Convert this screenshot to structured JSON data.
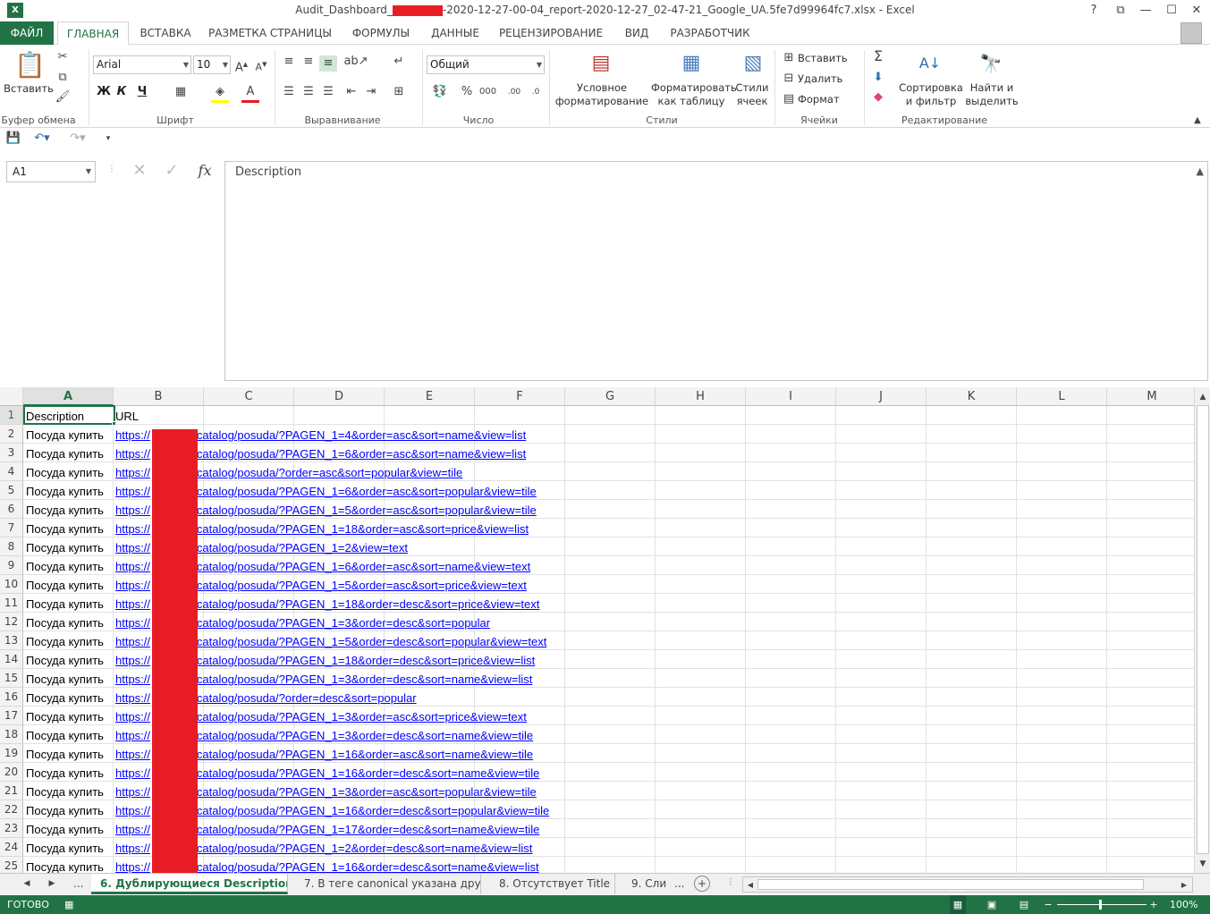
{
  "window": {
    "title_prefix": "Audit_Dashboard_",
    "title_suffix": "-2020-12-27-00-04_report-2020-12-27_02-47-21_Google_UA.5fe7d99964fc7.xlsx - Excel",
    "help": "?",
    "restore": "⧉",
    "minimize": "—",
    "maximize": "☐",
    "close": "✕"
  },
  "ribbon_tabs": [
    "ФАЙЛ",
    "ГЛАВНАЯ",
    "ВСТАВКА",
    "РАЗМЕТКА СТРАНИЦЫ",
    "ФОРМУЛЫ",
    "ДАННЫЕ",
    "РЕЦЕНЗИРОВАНИЕ",
    "ВИД",
    "РАЗРАБОТЧИК"
  ],
  "ribbon": {
    "paste": "Вставить",
    "font_name": "Arial",
    "font_size": "10",
    "bold": "Ж",
    "italic": "К",
    "underline": "Ч",
    "number_format": "Общий",
    "cond_format_1": "Условное",
    "cond_format_2": "форматирование",
    "format_table_1": "Форматировать",
    "format_table_2": "как таблицу",
    "cell_styles_1": "Стили",
    "cell_styles_2": "ячеек",
    "insert": "Вставить",
    "delete": "Удалить",
    "format": "Формат",
    "sort_1": "Сортировка",
    "sort_2": "и фильтр",
    "find_1": "Найти и",
    "find_2": "выделить",
    "groups": {
      "clipboard": "Буфер обмена",
      "font": "Шрифт",
      "alignment": "Выравнивание",
      "number": "Число",
      "styles": "Стили",
      "cells": "Ячейки",
      "editing": "Редактирование"
    }
  },
  "formula_bar": {
    "name_box": "A1",
    "fx": "fx",
    "content": "Description"
  },
  "columns": [
    "A",
    "B",
    "C",
    "D",
    "E",
    "F",
    "G",
    "H",
    "I",
    "J",
    "K",
    "L",
    "M"
  ],
  "rows": [
    {
      "n": "1",
      "a": "Description",
      "b": "URL"
    },
    {
      "n": "2",
      "a": "Посуда  купить",
      "b": "https://",
      "c": "u/catalog/posuda/?PAGEN_1=4&order=asc&sort=name&view=list"
    },
    {
      "n": "3",
      "a": "Посуда  купить",
      "b": "https://",
      "c": "u/catalog/posuda/?PAGEN_1=6&order=asc&sort=name&view=list"
    },
    {
      "n": "4",
      "a": "Посуда  купить",
      "b": "https://",
      "c": "u/catalog/posuda/?order=asc&sort=popular&view=tile"
    },
    {
      "n": "5",
      "a": "Посуда  купить",
      "b": "https://",
      "c": "u/catalog/posuda/?PAGEN_1=6&order=asc&sort=popular&view=tile"
    },
    {
      "n": "6",
      "a": "Посуда  купить",
      "b": "https://",
      "c": "u/catalog/posuda/?PAGEN_1=5&order=asc&sort=popular&view=tile"
    },
    {
      "n": "7",
      "a": "Посуда  купить",
      "b": "https://",
      "c": "u/catalog/posuda/?PAGEN_1=18&order=asc&sort=price&view=list"
    },
    {
      "n": "8",
      "a": "Посуда  купить",
      "b": "https://",
      "c": "u/catalog/posuda/?PAGEN_1=2&view=text"
    },
    {
      "n": "9",
      "a": "Посуда  купить",
      "b": "https://",
      "c": "u/catalog/posuda/?PAGEN_1=6&order=asc&sort=name&view=text"
    },
    {
      "n": "10",
      "a": "Посуда  купить",
      "b": "https://",
      "c": "u/catalog/posuda/?PAGEN_1=5&order=asc&sort=price&view=text"
    },
    {
      "n": "11",
      "a": "Посуда  купить",
      "b": "https://",
      "c": "u/catalog/posuda/?PAGEN_1=18&order=desc&sort=price&view=text"
    },
    {
      "n": "12",
      "a": "Посуда  купить",
      "b": "https://",
      "c": "u/catalog/posuda/?PAGEN_1=3&order=desc&sort=popular"
    },
    {
      "n": "13",
      "a": "Посуда  купить",
      "b": "https://",
      "c": "u/catalog/posuda/?PAGEN_1=5&order=desc&sort=popular&view=text"
    },
    {
      "n": "14",
      "a": "Посуда  купить",
      "b": "https://",
      "c": "u/catalog/posuda/?PAGEN_1=18&order=desc&sort=price&view=list"
    },
    {
      "n": "15",
      "a": "Посуда  купить",
      "b": "https://",
      "c": "u/catalog/posuda/?PAGEN_1=3&order=desc&sort=name&view=list"
    },
    {
      "n": "16",
      "a": "Посуда  купить",
      "b": "https://",
      "c": "u/catalog/posuda/?order=desc&sort=popular"
    },
    {
      "n": "17",
      "a": "Посуда  купить",
      "b": "https://",
      "c": "u/catalog/posuda/?PAGEN_1=3&order=asc&sort=price&view=text"
    },
    {
      "n": "18",
      "a": "Посуда  купить",
      "b": "https://",
      "c": "u/catalog/posuda/?PAGEN_1=3&order=desc&sort=name&view=tile"
    },
    {
      "n": "19",
      "a": "Посуда  купить",
      "b": "https://",
      "c": "u/catalog/posuda/?PAGEN_1=16&order=asc&sort=name&view=tile"
    },
    {
      "n": "20",
      "a": "Посуда  купить",
      "b": "https://",
      "c": "u/catalog/posuda/?PAGEN_1=16&order=desc&sort=name&view=tile"
    },
    {
      "n": "21",
      "a": "Посуда  купить",
      "b": "https://",
      "c": "u/catalog/posuda/?PAGEN_1=3&order=asc&sort=popular&view=tile"
    },
    {
      "n": "22",
      "a": "Посуда  купить",
      "b": "https://",
      "c": "u/catalog/posuda/?PAGEN_1=16&order=desc&sort=popular&view=tile"
    },
    {
      "n": "23",
      "a": "Посуда  купить",
      "b": "https://",
      "c": "u/catalog/posuda/?PAGEN_1=17&order=desc&sort=name&view=tile"
    },
    {
      "n": "24",
      "a": "Посуда  купить",
      "b": "https://",
      "c": "u/catalog/posuda/?PAGEN_1=2&order=desc&sort=name&view=list"
    },
    {
      "n": "25",
      "a": "Посуда  купить",
      "b": "https://",
      "c": "u/catalog/posuda/?PAGEN_1=16&order=desc&sort=name&view=list"
    }
  ],
  "sheet_tabs": {
    "ellipsis_left": "...",
    "active": "6. Дублирующиеся Description",
    "tab2": "7. В теге canonical указана дру",
    "tab3": "8. Отсутствует Title",
    "tab4": "9. Сли",
    "ellipsis_right": "..."
  },
  "status": {
    "ready": "ГОТОВО",
    "zoom": "100%"
  },
  "colors": {
    "excel_green": "#217346",
    "link": "#0000ff",
    "redaction": "#e81c24"
  }
}
